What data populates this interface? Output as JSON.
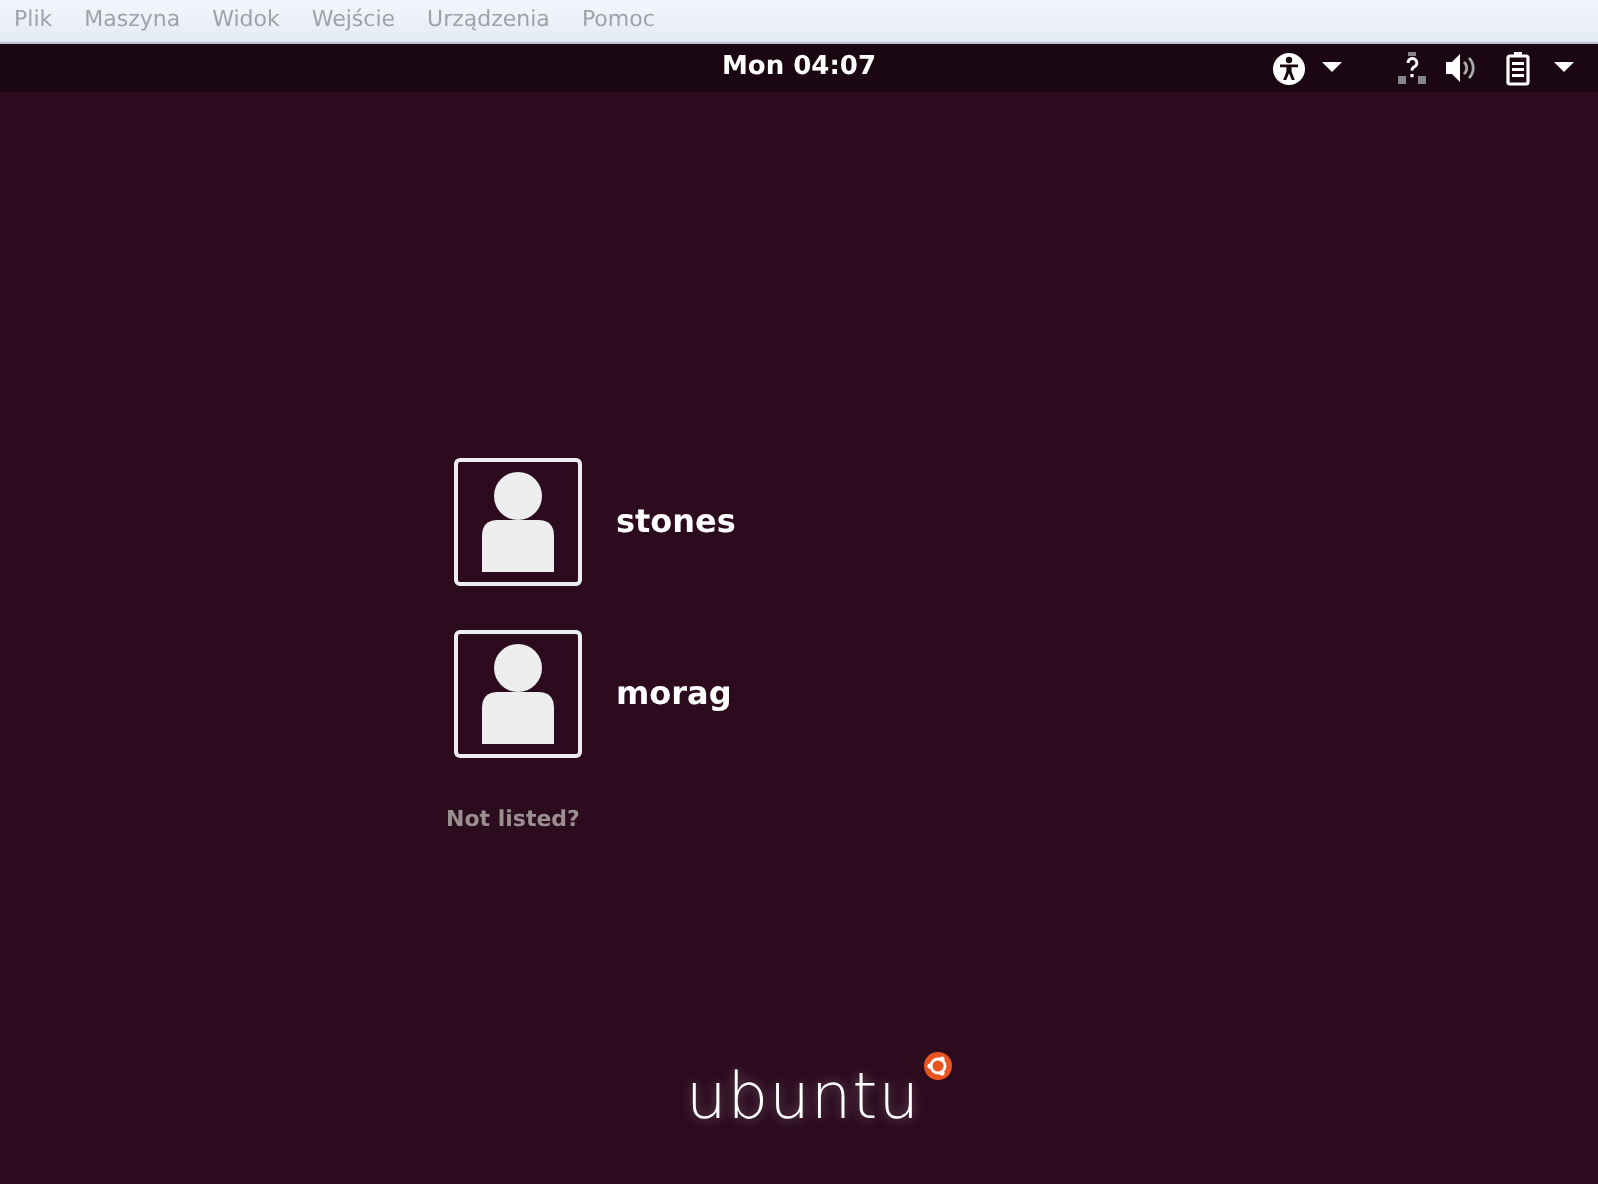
{
  "menu_bar": [
    "Plik",
    "Maszyna",
    "Widok",
    "Wejście",
    "Urządzenia",
    "Pomoc"
  ],
  "top_panel": {
    "clock": "Mon 04:07"
  },
  "users": [
    {
      "name": "stones"
    },
    {
      "name": "morag"
    }
  ],
  "not_listed": "Not listed?",
  "logo": "ubuntu"
}
